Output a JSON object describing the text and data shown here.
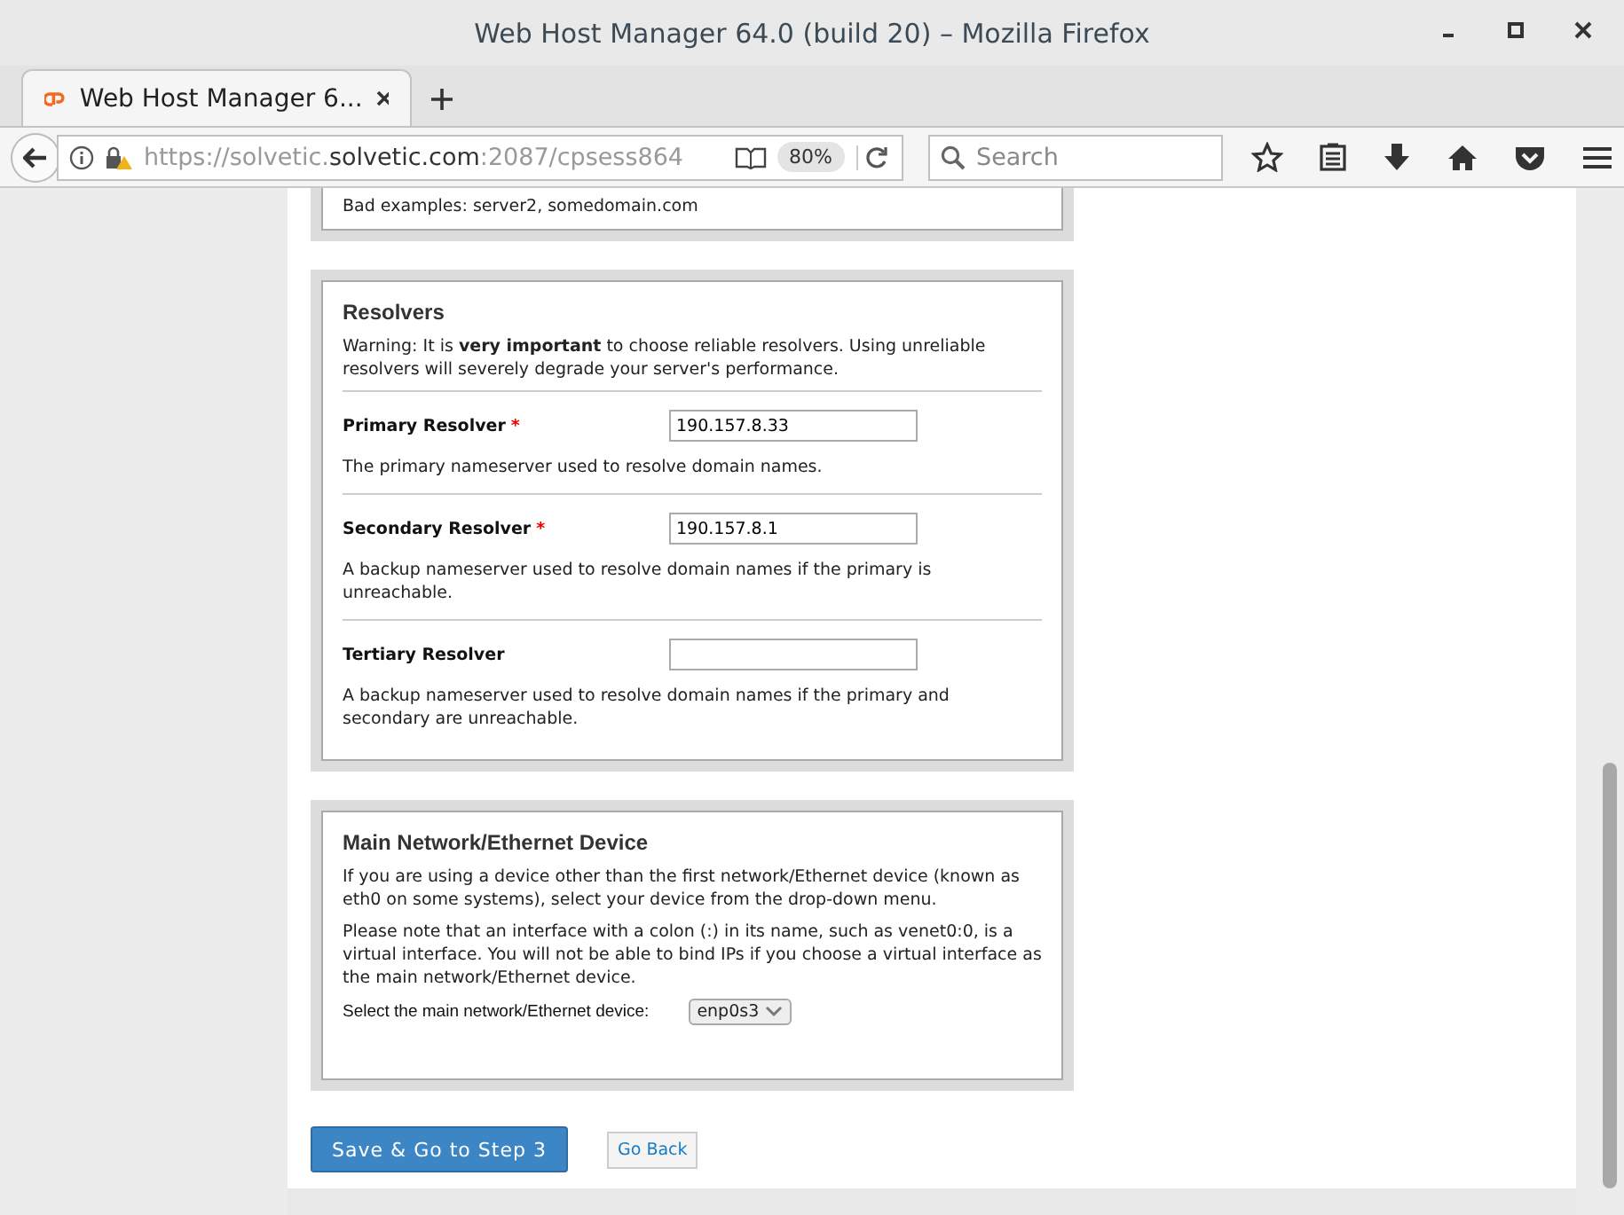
{
  "window": {
    "title": "Web Host Manager 64.0 (build 20) – Mozilla Firefox"
  },
  "tabs": [
    {
      "label": "Web Host Manager 6...",
      "selected": true
    }
  ],
  "nav": {
    "url_prefix": "https://solvetic.",
    "url_domain": "solvetic.com",
    "url_suffix": ":2087/cpsess864",
    "zoom": "80%",
    "search_placeholder": "Search"
  },
  "previous_section": {
    "text": "Bad examples: server2, somedomain.com"
  },
  "resolvers": {
    "title": "Resolvers",
    "warning": "Warning: It is **very important** to choose reliable resolvers. Using unreliable resolvers will severely degrade your server's performance.",
    "required_marker": "*",
    "fields": [
      {
        "label": "Primary Resolver",
        "required": true,
        "value": "190.157.8.33",
        "help": "The primary nameserver used to resolve domain names."
      },
      {
        "label": "Secondary Resolver",
        "required": true,
        "value": "190.157.8.1",
        "help": "A backup nameserver used to resolve domain names if the primary is unreachable."
      },
      {
        "label": "Tertiary Resolver",
        "required": false,
        "help": "A backup nameserver used to resolve domain names if the primary and secondary are unreachable."
      }
    ]
  },
  "network": {
    "title": "Main Network/Ethernet Device",
    "paragraphs": [
      "If you are using a device other than the first network/Ethernet device (known as eth0 on some systems), select your device from the drop-down menu.",
      "Please note that an interface with a colon (:) in its name, such as venet0:0, is a virtual interface. You will not be able to bind IPs if you choose a virtual interface as the main network/Ethernet device."
    ],
    "select_label": "Select the main network/Ethernet device:",
    "select_value": "enp0s3"
  },
  "buttons": {
    "primary": "Save & Go to Step 3",
    "secondary": "Go Back"
  }
}
